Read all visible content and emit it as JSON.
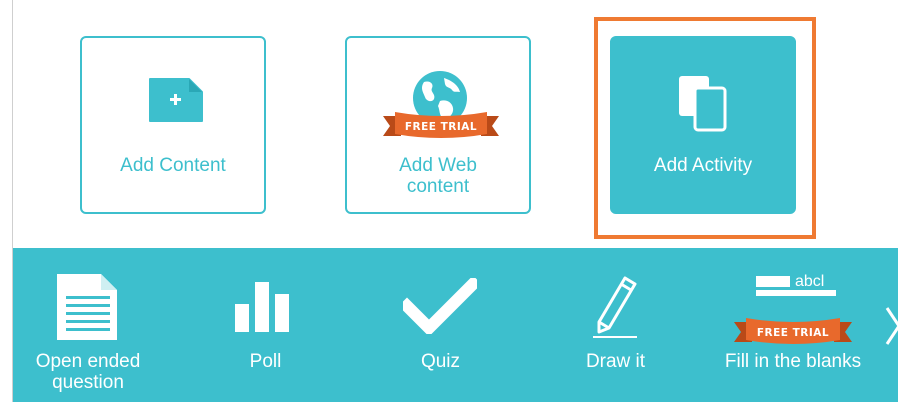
{
  "cards": {
    "add_content": {
      "label": "Add Content",
      "icon": "add-document-icon"
    },
    "add_web_content": {
      "label_line1": "Add Web",
      "label_line2": "content",
      "badge": "FREE TRIAL",
      "icon": "globe-icon"
    },
    "add_activity": {
      "label": "Add Activity",
      "icon": "copy-pages-icon",
      "selected": true
    }
  },
  "activities": [
    {
      "label_line1": "Open ended",
      "label_line2": "question",
      "icon": "document-lines-icon"
    },
    {
      "label": "Poll",
      "icon": "bar-chart-icon"
    },
    {
      "label": "Quiz",
      "icon": "checkmark-icon"
    },
    {
      "label": "Draw it",
      "icon": "pencil-icon"
    },
    {
      "label": "Fill in the blanks",
      "icon_text": "abcl",
      "badge": "FREE TRIAL",
      "icon": "fill-blanks-icon"
    }
  ],
  "colors": {
    "teal": "#3dbfcd",
    "selection_outline": "#ef7a32",
    "ribbon": "#e8692c",
    "ribbon_dark": "#b94a18"
  }
}
